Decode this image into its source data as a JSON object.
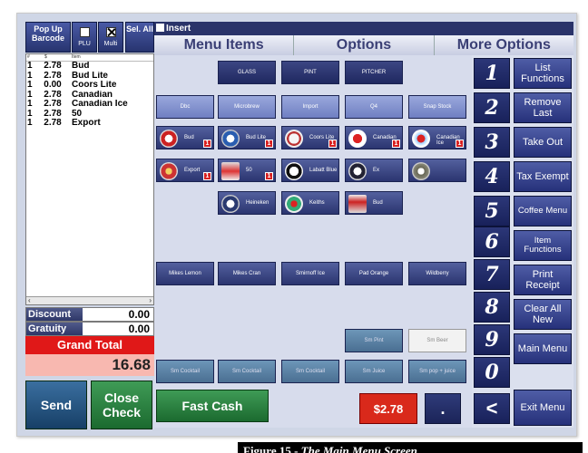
{
  "left_panel": {
    "popup_barcode": "Pop Up Barcode",
    "plu": "PLU",
    "multi": "Multi",
    "sel_all": "Sel. All",
    "ticket_header": {
      "qty": "#",
      "price": "$",
      "item": "Item"
    },
    "ticket_items": [
      {
        "qty": "1",
        "price": "2.78",
        "name": "Bud"
      },
      {
        "qty": "1",
        "price": "2.78",
        "name": "Bud Lite"
      },
      {
        "qty": "1",
        "price": "0.00",
        "name": "Coors Lite"
      },
      {
        "qty": "1",
        "price": "2.78",
        "name": "Canadian"
      },
      {
        "qty": "1",
        "price": "2.78",
        "name": "Canadian Ice"
      },
      {
        "qty": "1",
        "price": "2.78",
        "name": "50"
      },
      {
        "qty": "1",
        "price": "2.78",
        "name": "Export"
      }
    ],
    "discount_label": "Discount",
    "discount_value": "0.00",
    "gratuity_label": "Gratuity",
    "gratuity_value": "0.00",
    "grand_total_label": "Grand Total",
    "grand_total_value": "16.68",
    "send": "Send",
    "close_check": "Close Check"
  },
  "main": {
    "insert": "Insert",
    "tabs": [
      "Menu Items",
      "Options",
      "More Options"
    ],
    "row1": [
      "GLASS",
      "PINT",
      "PITCHER"
    ],
    "row2": [
      "Dbc",
      "Microbrew",
      "Import",
      "Q4",
      "Snap Stock"
    ],
    "row3": [
      "Bud",
      "Bud Lite",
      "Coors Lite",
      "Canadian",
      "Canadian Ice"
    ],
    "row4": [
      "Export",
      "50",
      "Labatt Blue",
      "Ex"
    ],
    "row5": [
      "Heineken",
      "Keiths"
    ],
    "row6": [
      "Bud"
    ],
    "mixers": [
      "Mikes Lemon",
      "Mikes Cran",
      "Smirnoff Ice",
      "Pad Orange",
      "Wildberry"
    ],
    "lower_right": [
      "Sm Pint",
      "Sm Beer"
    ],
    "bottom_row": [
      "Sm Cocktail",
      "Sm Cocktail",
      "Sm Cocktail",
      "Sm Juice",
      "Sm pop + juice"
    ],
    "fast_cash": "Fast Cash",
    "price": "$2.78",
    "dot": "."
  },
  "keypad": [
    "1",
    "2",
    "3",
    "4",
    "5",
    "6",
    "7",
    "8",
    "9",
    "0",
    "<"
  ],
  "functions": [
    "List Functions",
    "Remove Last",
    "Take Out",
    "Tax Exempt",
    "Coffee Menu",
    "Item Functions",
    "Print Receipt",
    "Clear All New",
    "Main Menu",
    "Exit Menu"
  ],
  "caption": {
    "prefix": "Figure 15 - ",
    "title": "The Main Menu Screen"
  },
  "colors": {
    "navy": "#27346f",
    "green": "#1b6a2f",
    "red": "#e01818",
    "pink": "#f8b8b0"
  }
}
